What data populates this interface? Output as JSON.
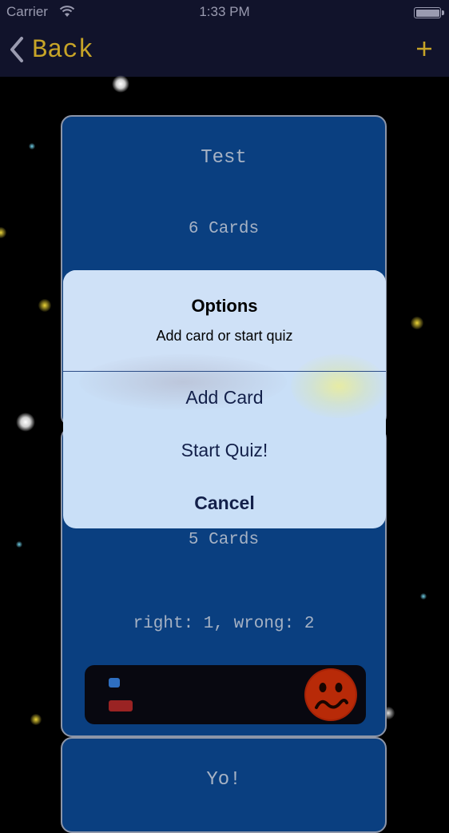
{
  "status_bar": {
    "carrier": "Carrier",
    "time": "1:33 PM"
  },
  "nav": {
    "back_label": "Back",
    "back_icon": "chevron-left-icon",
    "add_icon": "plus-icon",
    "accent": "#c7a427"
  },
  "decks": [
    {
      "title": "Test",
      "count": "6 Cards"
    },
    {
      "count": "5 Cards",
      "score": "right: 1, wrong: 2",
      "right_fraction": 0.333,
      "wrong_fraction": 0.667,
      "mood": "sad"
    },
    {
      "title": "Yo!"
    }
  ],
  "action_sheet": {
    "title": "Options",
    "message": "Add card or start quiz",
    "actions": [
      {
        "label": "Add Card"
      },
      {
        "label": "Start Quiz!"
      },
      {
        "label": "Cancel"
      }
    ]
  },
  "colors": {
    "background": "#000000",
    "navbar": "#11132b",
    "card": "#0a3f80",
    "sheet": "#c9dff7"
  }
}
